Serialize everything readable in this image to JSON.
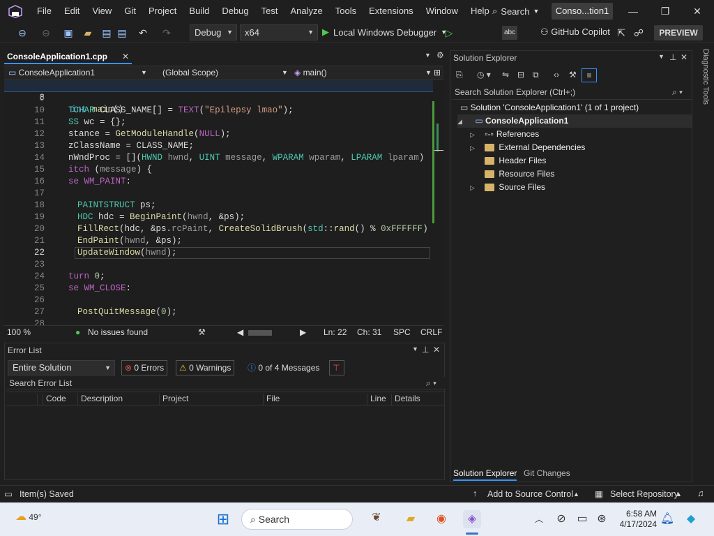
{
  "titlebar": {
    "menu": [
      "File",
      "Edit",
      "View",
      "Git",
      "Project",
      "Build",
      "Debug",
      "Test",
      "Analyze",
      "Tools",
      "Extensions",
      "Window",
      "Help"
    ],
    "search_label": "Search",
    "solution_badge": "Conso...tion1"
  },
  "toolbar": {
    "config": "Debug",
    "platform": "x64",
    "debugger_label": "Local Windows Debugger",
    "copilot_label": "GitHub Copilot",
    "preview_label": "PREVIEW"
  },
  "editor": {
    "tab_label": "ConsoleApplication1.cpp",
    "nav_project": "ConsoleApplication1",
    "nav_scope": "(Global Scope)",
    "nav_member": "main()",
    "sticky_line_number": "8",
    "line_numbers": [
      "9",
      "10",
      "11",
      "12",
      "13",
      "14",
      "15",
      "16",
      "17",
      "18",
      "19",
      "20",
      "21",
      "22",
      "23",
      "24",
      "25",
      "26",
      "27",
      "28"
    ],
    "current_line": "22"
  },
  "statusline": {
    "zoom": "100 %",
    "issues": "No issues found",
    "ln": "Ln: 22",
    "ch": "Ch: 31",
    "spc": "SPC",
    "eol": "CRLF"
  },
  "errorlist": {
    "title": "Error List",
    "scope": "Entire Solution",
    "errors": "0 Errors",
    "warnings": "0 Warnings",
    "messages": "0 of 4 Messages",
    "search_placeholder": "Search Error List",
    "columns": [
      "Code",
      "Description",
      "Project",
      "File",
      "Line",
      "Details"
    ]
  },
  "solution_explorer": {
    "title": "Solution Explorer",
    "search_placeholder": "Search Solution Explorer (Ctrl+;)",
    "solution": "Solution 'ConsoleApplication1' (1 of 1 project)",
    "project": "ConsoleApplication1",
    "items": [
      "References",
      "External Dependencies",
      "Header Files",
      "Resource Files",
      "Source Files"
    ],
    "tabs": [
      "Solution Explorer",
      "Git Changes"
    ]
  },
  "side_tab": "Diagnostic Tools",
  "statusbar": {
    "left": "Item(s) Saved",
    "source_control": "Add to Source Control",
    "repo": "Select Repository"
  },
  "taskbar": {
    "weather": "49°",
    "search": "Search",
    "time": "6:58 AM",
    "date": "4/17/2024"
  },
  "colors": {
    "accent": "#3794ff",
    "editor_bg": "#1e1e1e",
    "chrome_bg": "#1f1f1f",
    "taskbar_bg": "#e9eef6"
  }
}
